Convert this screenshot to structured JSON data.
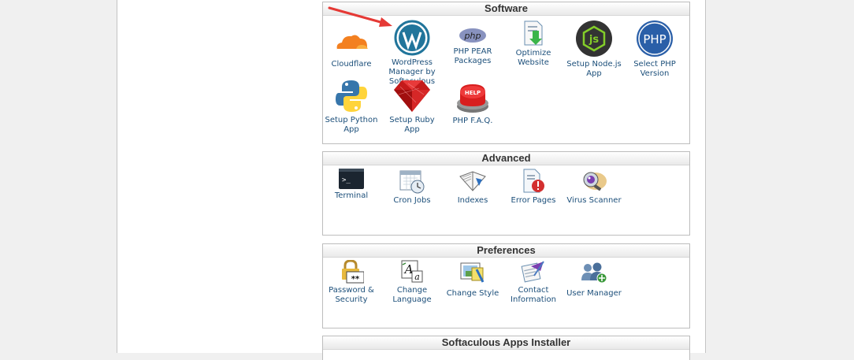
{
  "sections": {
    "software": {
      "title": "Software",
      "items": [
        {
          "label": "Cloudflare",
          "icon": "cloudflare-icon"
        },
        {
          "label": "WordPress Manager by Softaculous",
          "icon": "wordpress-icon"
        },
        {
          "label": "PHP PEAR Packages",
          "icon": "php-pear-icon"
        },
        {
          "label": "Optimize Website",
          "icon": "optimize-website-icon"
        },
        {
          "label": "Setup Node.js App",
          "icon": "nodejs-icon"
        },
        {
          "label": "Select PHP Version",
          "icon": "php-version-icon"
        },
        {
          "label": "Setup Python App",
          "icon": "python-icon"
        },
        {
          "label": "Setup Ruby App",
          "icon": "ruby-icon"
        },
        {
          "label": "PHP F.A.Q.",
          "icon": "help-button-icon"
        }
      ]
    },
    "advanced": {
      "title": "Advanced",
      "items": [
        {
          "label": "Terminal",
          "icon": "terminal-icon"
        },
        {
          "label": "Cron Jobs",
          "icon": "calendar-clock-icon"
        },
        {
          "label": "Indexes",
          "icon": "book-icon"
        },
        {
          "label": "Error Pages",
          "icon": "error-page-icon"
        },
        {
          "label": "Virus Scanner",
          "icon": "virus-scanner-icon"
        }
      ]
    },
    "preferences": {
      "title": "Preferences",
      "items": [
        {
          "label": "Password & Security",
          "icon": "padlock-icon"
        },
        {
          "label": "Change Language",
          "icon": "language-icon"
        },
        {
          "label": "Change Style",
          "icon": "palette-icon"
        },
        {
          "label": "Contact Information",
          "icon": "contact-icon"
        },
        {
          "label": "User Manager",
          "icon": "user-manager-icon"
        }
      ]
    },
    "softaculous": {
      "title": "Softaculous Apps Installer"
    }
  },
  "icon_text": {
    "php": "php",
    "php_big": "PHP",
    "help": "HELP",
    "terminal_prompt": ">_",
    "lang_a": "A",
    "lang_a_small": "a",
    "password_stars": "**"
  },
  "colors": {
    "link": "#1c4f7a",
    "header_text": "#333333",
    "annotation_arrow": "#e53935"
  }
}
